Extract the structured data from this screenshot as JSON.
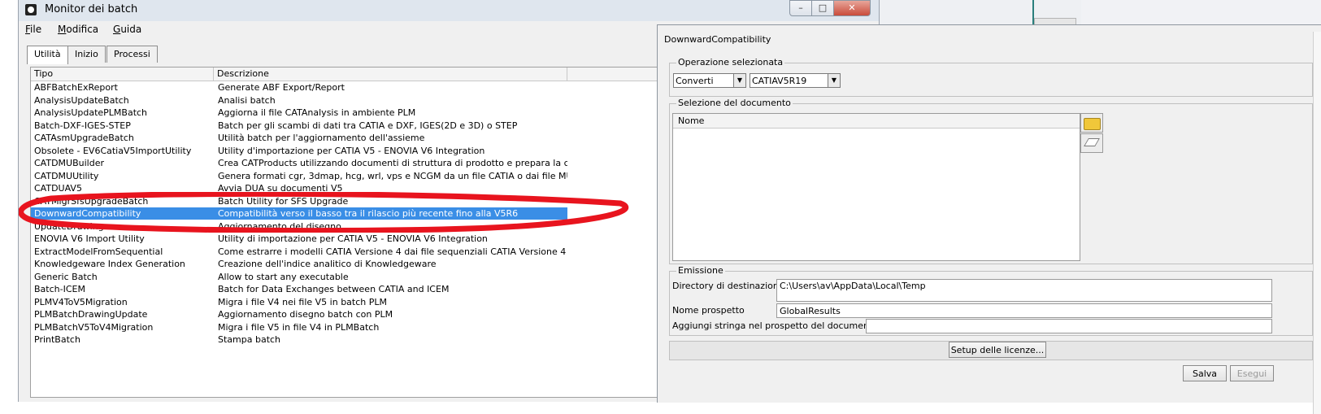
{
  "monitor": {
    "title": "Monitor dei batch",
    "menu": [
      "File",
      "Modifica",
      "Guida"
    ],
    "tabs": [
      "Utilità",
      "Inizio",
      "Processi"
    ],
    "columns": [
      "Tipo",
      "Descrizione"
    ],
    "rows": [
      {
        "tipo": "ABFBatchExReport",
        "desc": "Generate ABF Export/Report"
      },
      {
        "tipo": "AnalysisUpdateBatch",
        "desc": "Analisi batch"
      },
      {
        "tipo": "AnalysisUpdatePLMBatch",
        "desc": "Aggiorna il file CATAnalysis in ambiente PLM"
      },
      {
        "tipo": "Batch-DXF-IGES-STEP",
        "desc": "Batch per gli scambi di dati tra CATIA e DXF, IGES(2D e 3D) o STEP"
      },
      {
        "tipo": "CATAsmUpgradeBatch",
        "desc": "Utilità batch per l'aggiornamento dell'assieme"
      },
      {
        "tipo": "Obsolete - EV6CatiaV5ImportUtility",
        "desc": "Utility d'importazione per CATIA V5 - ENOVIA V6 Integration"
      },
      {
        "tipo": "CATDMUBuilder",
        "desc": "Crea CATProducts utilizzando documenti di struttura di prodotto e prepara la cache"
      },
      {
        "tipo": "CATDMUUtility",
        "desc": "Genera formati cgr, 3dmap, hcg, wrl, vps e NCGM da un file CATIA o dai file MUL..."
      },
      {
        "tipo": "CATDUAV5",
        "desc": "Avvia DUA su documenti V5"
      },
      {
        "tipo": "CATMigrSfsUpgradeBatch",
        "desc": "Batch Utility for SFS Upgrade"
      },
      {
        "tipo": "DownwardCompatibility",
        "desc": "Compatibilità verso il basso tra il rilascio più recente fino alla V5R6"
      },
      {
        "tipo": "UpdateDrawing",
        "desc": "Aggiornamento del disegno"
      },
      {
        "tipo": "ENOVIA V6 Import Utility",
        "desc": "Utility di importazione per CATIA V5 - ENOVIA V6 Integration"
      },
      {
        "tipo": "ExtractModelFromSequential",
        "desc": "Come estrarre i modelli CATIA Versione 4 dai file sequenziali CATIA Versione 4"
      },
      {
        "tipo": "Knowledgeware Index Generation",
        "desc": "Creazione dell'indice analitico di Knowledgeware"
      },
      {
        "tipo": "Generic Batch",
        "desc": "Allow to start any executable"
      },
      {
        "tipo": "Batch-ICEM",
        "desc": "Batch for Data Exchanges between CATIA and ICEM"
      },
      {
        "tipo": "PLMV4ToV5Migration",
        "desc": "Migra i file V4 nei file V5 in batch PLM"
      },
      {
        "tipo": "PLMBatchDrawingUpdate",
        "desc": "Aggiornamento disegno batch con PLM"
      },
      {
        "tipo": "PLMBatchV5ToV4Migration",
        "desc": "Migra i file V5 in file V4 in PLMBatch"
      },
      {
        "tipo": "PrintBatch",
        "desc": "Stampa batch"
      }
    ],
    "selected_index": 10
  },
  "dialog": {
    "title": "DownwardCompatibility",
    "operazione": {
      "label": "Operazione selezionata",
      "action": "Converti",
      "target": "CATIAV5R19"
    },
    "selezione": {
      "label": "Selezione del documento",
      "column": "Nome"
    },
    "emissione": {
      "label": "Emissione",
      "dir_label": "Directory di destinazione",
      "dir_value": "C:\\Users\\av\\AppData\\Local\\Temp",
      "report_label": "Nome prospetto",
      "report_value": "GlobalResults",
      "string_label": "Aggiungi stringa nel prospetto del documento",
      "string_value": ""
    },
    "setup_button": "Setup delle licenze...",
    "save_button": "Salva",
    "run_button": "Esegui"
  },
  "colors": {
    "selection": "#3a8ee6",
    "annotation": "#e8141e"
  }
}
